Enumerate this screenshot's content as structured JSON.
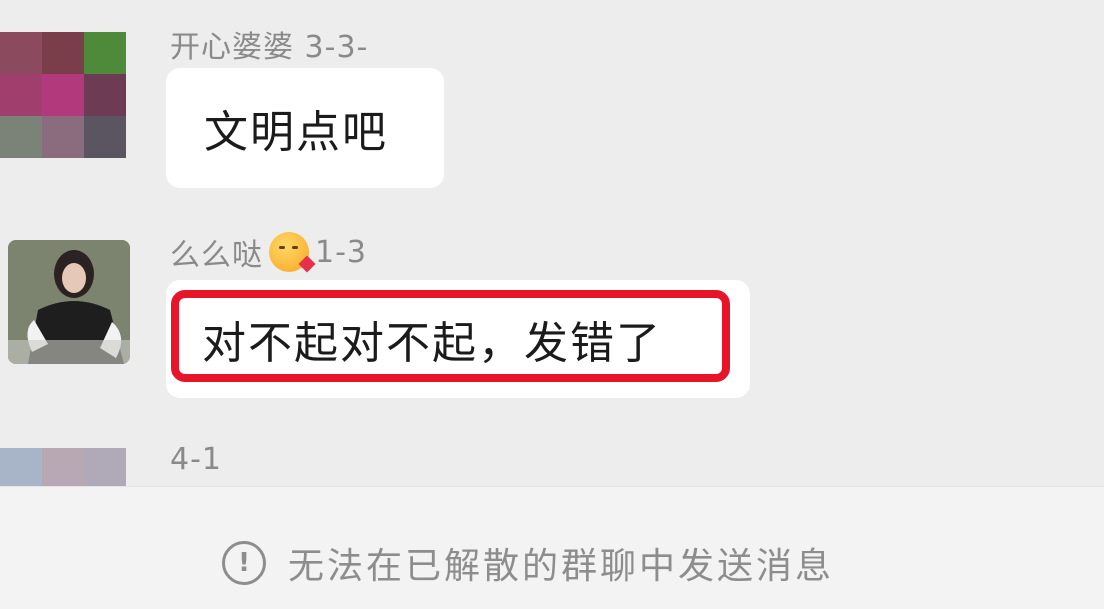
{
  "messages": [
    {
      "sender": "开心婆婆 3-3-",
      "text": "文明点吧",
      "avatar_colors": [
        "#8b4a5e",
        "#7a3e4a",
        "#4e8a3a",
        "#a03f6e",
        "#b23a7c",
        "#6e3b55",
        "#7b8278",
        "#8b6c7e",
        "#5a5560"
      ]
    },
    {
      "sender": "么么哒",
      "sender_suffix": "1-3",
      "sender_emoji": "face-blowing-kiss-emoji",
      "text": "对不起对不起，发错了",
      "highlighted": true,
      "highlight_color": "#e8152a"
    },
    {
      "sender": "4-1",
      "avatar_colors": [
        "#a8b4c8",
        "#b8a8b4",
        "#b0aab8"
      ]
    }
  ],
  "footer": {
    "icon": "info-circle-icon",
    "icon_glyph": "!",
    "notice": "无法在已解散的群聊中发送消息"
  },
  "colors": {
    "background": "#ededed",
    "bubble": "#ffffff",
    "name_text": "#8a8a8a",
    "highlight": "#e8152a"
  }
}
